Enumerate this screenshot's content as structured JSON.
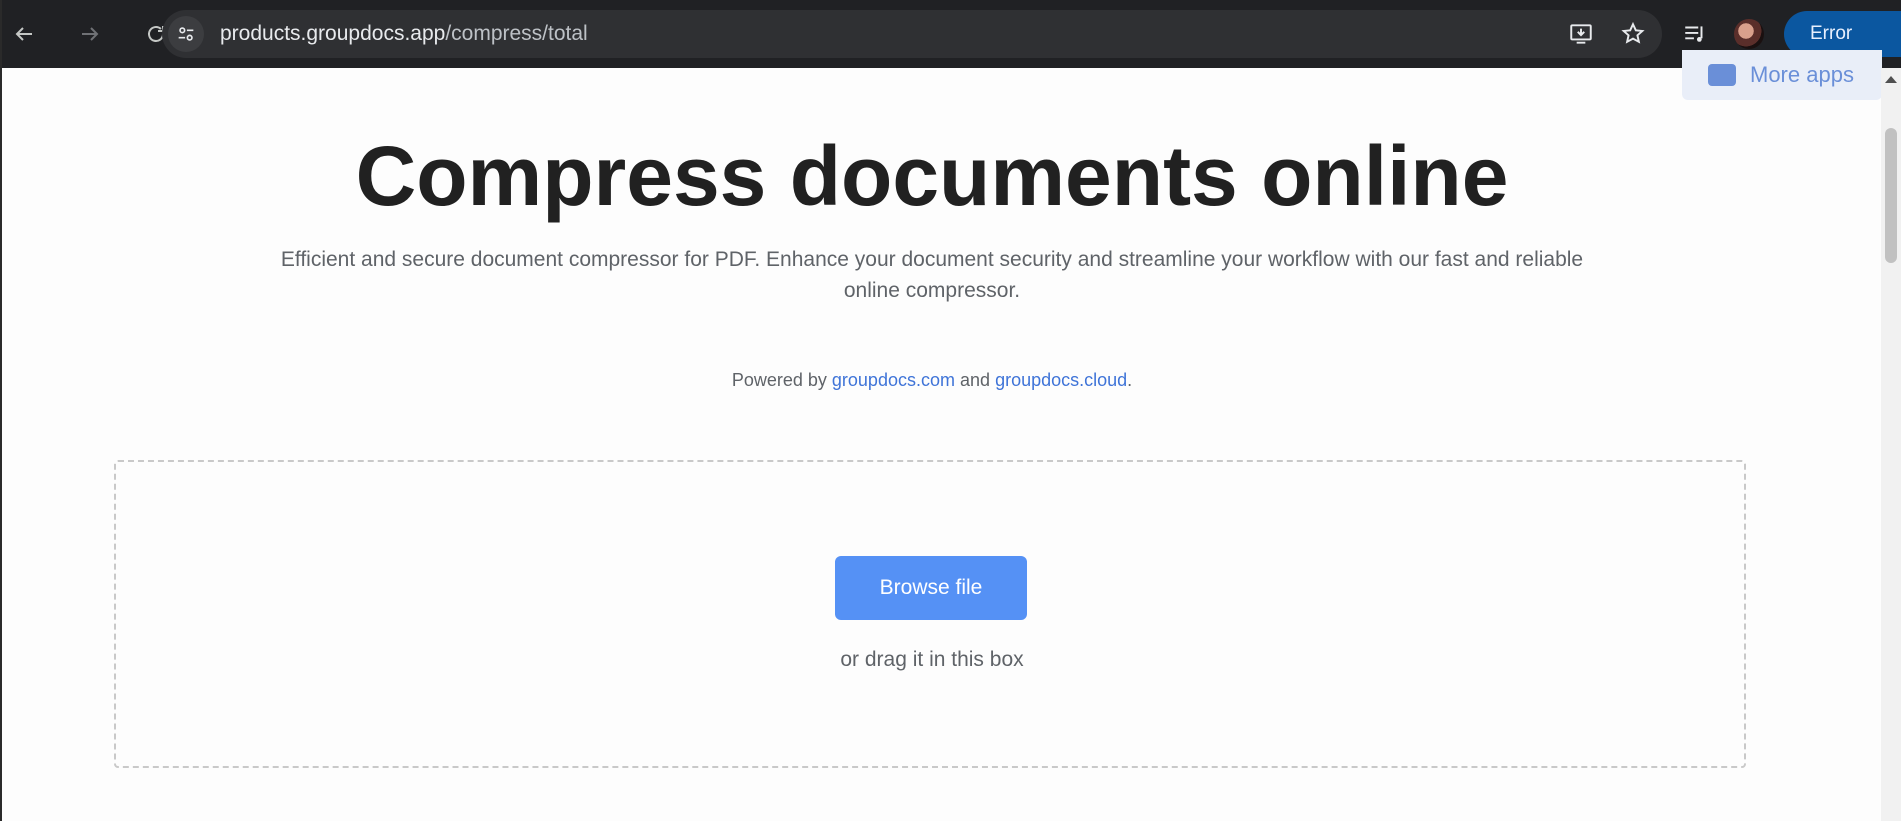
{
  "browser": {
    "url_host": "products.groupdocs.app",
    "url_path": "/compress/total",
    "profile_status": "Error"
  },
  "page": {
    "more_apps_label": "More apps",
    "title": "Compress documents online",
    "subtitle": "Efficient and secure document compressor for PDF. Enhance your document security and streamline your workflow with our fast and reliable online compressor.",
    "powered_prefix": "Powered by",
    "powered_link1": "groupdocs.com",
    "powered_and": "and",
    "powered_link2": "groupdocs.cloud",
    "powered_suffix": ".",
    "browse_button": "Browse file",
    "drag_hint": "or drag it in this box"
  },
  "colors": {
    "toolbar": "#202124",
    "accent_button": "#5591f5",
    "link": "#3f74d8",
    "error_pill": "#0b57a0"
  }
}
